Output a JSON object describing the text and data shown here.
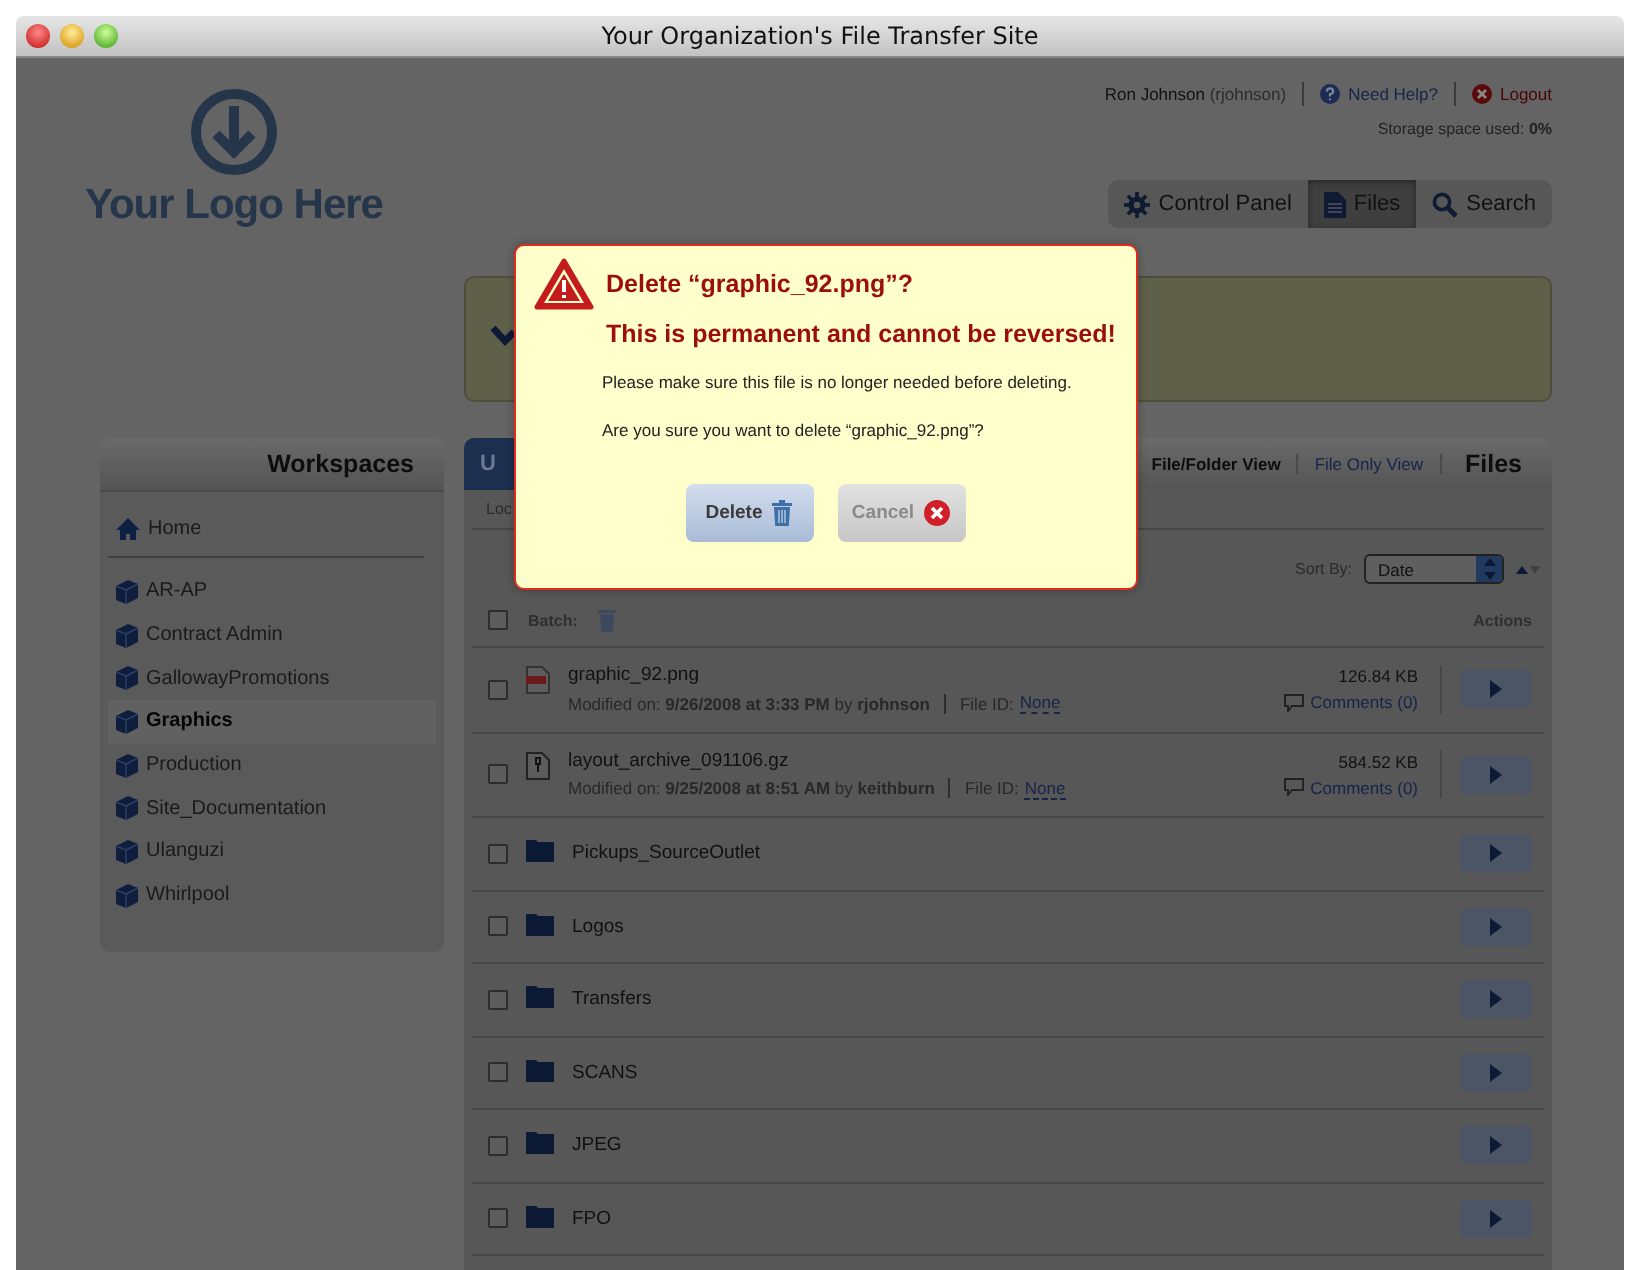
{
  "window": {
    "title": "Your Organization's File Transfer Site"
  },
  "logo": {
    "text": "Your Logo Here"
  },
  "user_bar": {
    "name": "Ron Johnson",
    "username": "(rjohnson)",
    "help": "Need Help?",
    "logout": "Logout",
    "storage_label": "Storage space used:",
    "storage_value": "0%"
  },
  "nav_tabs": [
    {
      "label": "Control Panel",
      "kind": "settings",
      "selected": false
    },
    {
      "label": "Files",
      "kind": "files",
      "selected": true
    },
    {
      "label": "Search",
      "kind": "search",
      "selected": false
    }
  ],
  "sidebar": {
    "title": "Workspaces",
    "home": "Home",
    "items": [
      {
        "label": "AR-AP",
        "selected": false
      },
      {
        "label": "Contract Admin",
        "selected": false
      },
      {
        "label": "GallowayPromotions",
        "selected": false
      },
      {
        "label": "Graphics",
        "selected": true
      },
      {
        "label": "Production",
        "selected": false
      },
      {
        "label": "Site_Documentation",
        "selected": false
      },
      {
        "label": "Ulanguzi",
        "selected": false
      },
      {
        "label": "Whirlpool",
        "selected": false
      }
    ]
  },
  "files_panel": {
    "tab": "U",
    "views": [
      {
        "label": "File/Folder View",
        "selected": true
      },
      {
        "label": "File Only View",
        "selected": false
      }
    ],
    "title": "Files",
    "breadcrumb": "Loc",
    "sort_label": "Sort By:",
    "sort_value": "Date",
    "batch_label": "Batch:",
    "batch_checked": false,
    "actions_label": "Actions",
    "rows": [
      {
        "kind": "image",
        "name": "graphic_92.png",
        "checked": false,
        "modified": "Modified on: **9/26/2008 at 3:33 PM** by **rjohnson**",
        "file_id_label": "File ID:",
        "file_id": "None",
        "size": "126.84 KB",
        "comments": "Comments (0)"
      },
      {
        "kind": "archive",
        "name": "layout_archive_091106.gz",
        "checked": false,
        "modified": "Modified on: **9/25/2008 at 8:51 AM** by **keithburn**",
        "file_id_label": "File ID:",
        "file_id": "None",
        "size": "584.52 KB",
        "comments": "Comments (0)"
      },
      {
        "kind": "folder",
        "name": "Pickups_SourceOutlet",
        "checked": false
      },
      {
        "kind": "folder",
        "name": "Logos",
        "checked": false
      },
      {
        "kind": "folder",
        "name": "Transfers",
        "checked": false
      },
      {
        "kind": "folder",
        "name": "SCANS",
        "checked": false
      },
      {
        "kind": "folder",
        "name": "JPEG",
        "checked": false
      },
      {
        "kind": "folder",
        "name": "FPO",
        "checked": false
      }
    ]
  },
  "dialog": {
    "title": "Delete “graphic_92.png”?",
    "warning": "This is permanent and cannot be reversed!",
    "message": "Please make sure this file is no longer needed before deleting.",
    "question": "Are you sure you want to delete “graphic_92.png”?",
    "buttons": [
      {
        "label": "Delete",
        "kind": "delete"
      },
      {
        "label": "Cancel",
        "kind": "cancel"
      }
    ]
  }
}
